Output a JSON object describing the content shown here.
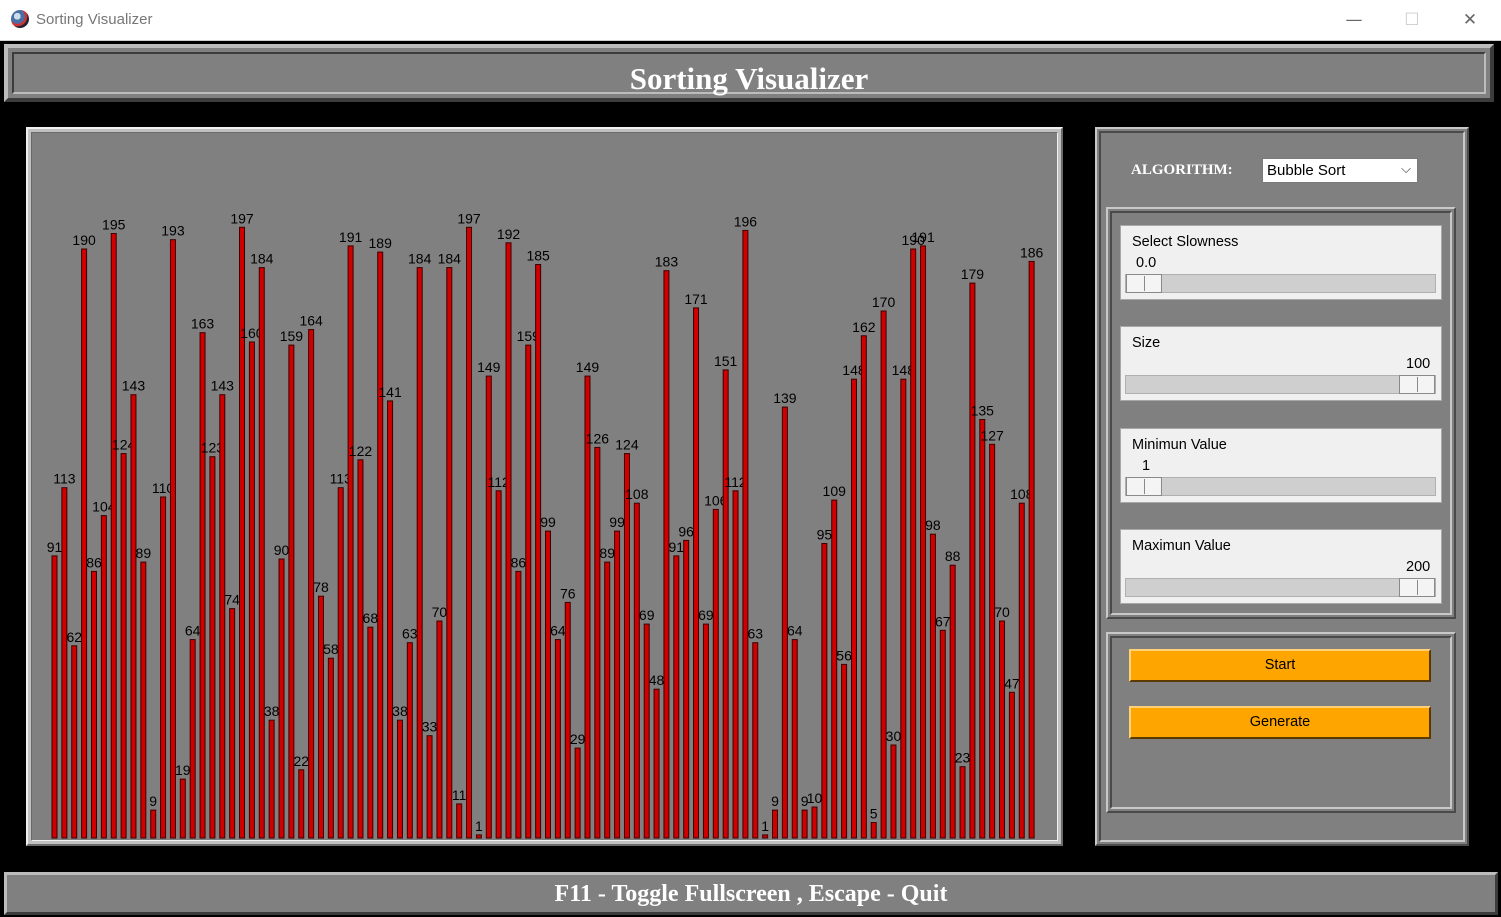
{
  "window": {
    "title": "Sorting Visualizer",
    "minimize": "—",
    "maximize": "☐",
    "close": "✕"
  },
  "header": {
    "title": "Sorting Visualizer"
  },
  "controls": {
    "algorithm_label": "ALGORITHM:",
    "algorithm_value": "Bubble Sort",
    "slowness": {
      "label": "Select Slowness",
      "value": "0.0",
      "level": 0
    },
    "size": {
      "label": "Size",
      "value": "100",
      "level": 1
    },
    "min_value": {
      "label": "Minimun Value",
      "value": "1",
      "level": 0
    },
    "max_value": {
      "label": "Maximun Value",
      "value": "200",
      "level": 1
    },
    "start_label": "Start",
    "generate_label": "Generate"
  },
  "footer": {
    "text": "F11 - Toggle Fullscreen , Escape - Quit"
  },
  "colors": {
    "bar_fill": "#d00000",
    "bar_outline": "#3a0000",
    "canvas_bg": "#808080",
    "button": "#ffa500"
  },
  "chart_data": {
    "type": "bar",
    "ylim": [
      0,
      200
    ],
    "values": [
      91,
      113,
      62,
      190,
      86,
      104,
      195,
      124,
      143,
      89,
      9,
      110,
      193,
      19,
      64,
      163,
      123,
      143,
      74,
      197,
      160,
      184,
      38,
      90,
      159,
      22,
      164,
      78,
      58,
      113,
      191,
      122,
      68,
      189,
      141,
      38,
      63,
      184,
      33,
      70,
      184,
      11,
      197,
      1,
      149,
      112,
      192,
      86,
      159,
      185,
      99,
      64,
      76,
      29,
      149,
      126,
      89,
      99,
      124,
      108,
      69,
      48,
      183,
      91,
      96,
      171,
      69,
      106,
      151,
      112,
      196,
      63,
      1,
      9,
      139,
      64,
      9,
      10,
      95,
      109,
      56,
      148,
      162,
      5,
      170,
      30,
      148,
      190,
      191,
      98,
      67,
      88,
      23,
      179,
      135,
      127,
      70,
      47,
      108,
      186
    ],
    "values_by_label": "each value printed as a data label above its bar"
  }
}
